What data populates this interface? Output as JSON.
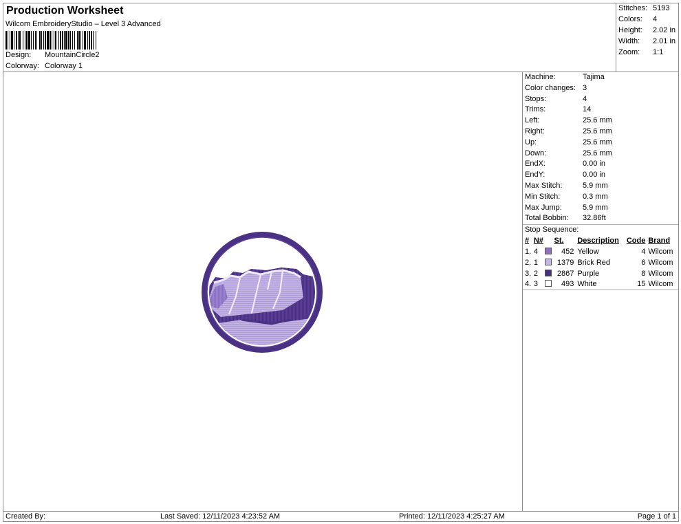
{
  "header": {
    "title": "Production Worksheet",
    "subtitle": "Wilcom EmbroideryStudio – Level 3 Advanced",
    "design_label": "Design:",
    "design_value": "MountainCircle2",
    "colorway_label": "Colorway:",
    "colorway_value": "Colorway 1"
  },
  "summary": [
    {
      "label": "Stitches:",
      "value": "5193"
    },
    {
      "label": "Colors:",
      "value": "4"
    },
    {
      "label": "Height:",
      "value": "2.02 in"
    },
    {
      "label": "Width:",
      "value": "2.01 in"
    },
    {
      "label": "Zoom:",
      "value": "1:1"
    }
  ],
  "details": [
    {
      "label": "Machine:",
      "value": "Tajima"
    },
    {
      "label": "Color changes:",
      "value": "3"
    },
    {
      "label": "Stops:",
      "value": "4"
    },
    {
      "label": "Trims:",
      "value": "14"
    },
    {
      "label": "Left:",
      "value": "25.6 mm"
    },
    {
      "label": "Right:",
      "value": "25.6 mm"
    },
    {
      "label": "Up:",
      "value": "25.6 mm"
    },
    {
      "label": "Down:",
      "value": "25.6 mm"
    },
    {
      "label": "EndX:",
      "value": "0.00 in"
    },
    {
      "label": "EndY:",
      "value": "0.00 in"
    },
    {
      "label": "Max Stitch:",
      "value": "5.9 mm"
    },
    {
      "label": "Min Stitch:",
      "value": "0.3 mm"
    },
    {
      "label": "Max Jump:",
      "value": "5.9 mm"
    },
    {
      "label": "Total Bobbin:",
      "value": "32.86ft"
    }
  ],
  "stop_sequence": {
    "title": "Stop Sequence:",
    "headers": {
      "num": "#",
      "n": "N#",
      "st": "St.",
      "desc": "Description",
      "code": "Code",
      "brand": "Brand"
    },
    "rows": [
      {
        "num": "1.",
        "n": "4",
        "color": "#8e6ec8",
        "st": "452",
        "desc": "Yellow",
        "code": "4",
        "brand": "Wilcom"
      },
      {
        "num": "2.",
        "n": "1",
        "color": "#c6b4e6",
        "st": "1379",
        "desc": "Brick Red",
        "code": "6",
        "brand": "Wilcom"
      },
      {
        "num": "3.",
        "n": "2",
        "color": "#4b2f86",
        "st": "2867",
        "desc": "Purple",
        "code": "8",
        "brand": "Wilcom"
      },
      {
        "num": "4.",
        "n": "3",
        "color": "#ffffff",
        "st": "493",
        "desc": "White",
        "code": "15",
        "brand": "Wilcom"
      }
    ]
  },
  "footer": {
    "created_by": "Created By:",
    "last_saved": "Last Saved: 12/11/2023 4:23:52 AM",
    "printed": "Printed: 12/11/2023 4:25:27 AM",
    "page": "Page 1 of 1"
  }
}
